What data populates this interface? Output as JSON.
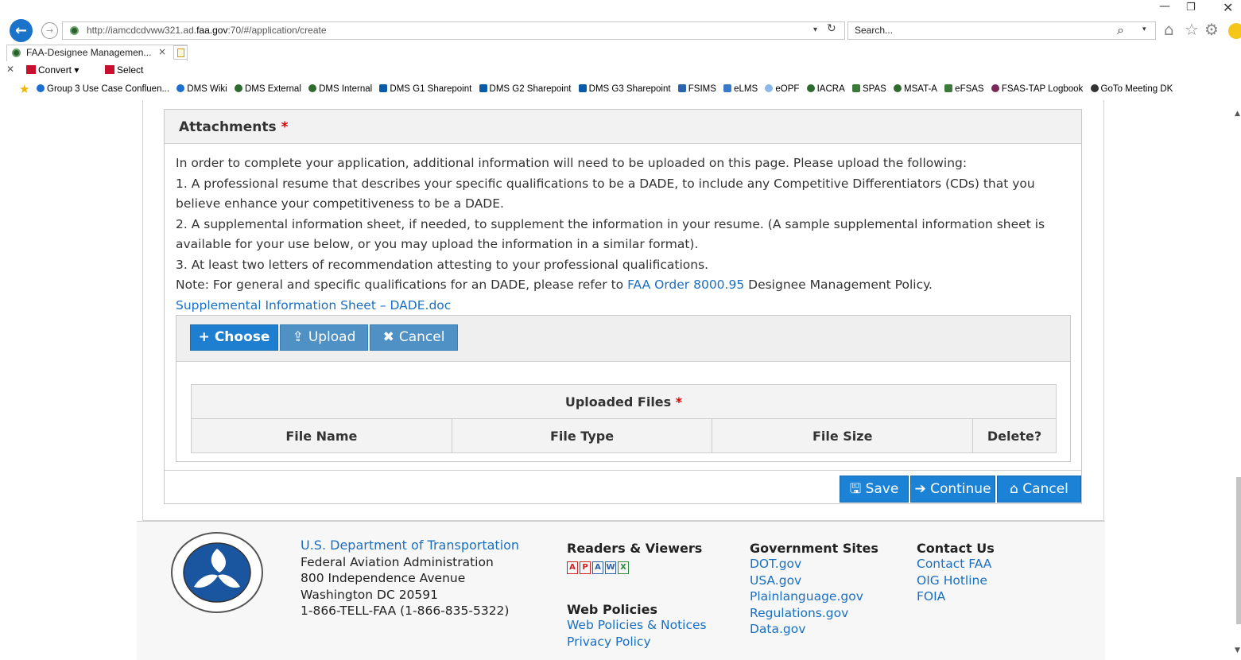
{
  "browser": {
    "url_prefix": "http://iamcdcdvww321.ad.",
    "url_domain": "faa.gov",
    "url_suffix": ":70/#/application/create",
    "search_placeholder": "Search...",
    "tab_title": "FAA-Designee Managemen...",
    "tab_close": "×",
    "window_min": "—",
    "window_restore": "❐",
    "window_close": "✕",
    "command_bar": {
      "close": "✕",
      "convert": "Convert",
      "convert_caret": "▾",
      "select": "Select"
    },
    "favorites": [
      "Group 3 Use Case Confluen...",
      "DMS Wiki",
      "DMS External",
      "DMS Internal",
      "DMS G1 Sharepoint",
      "DMS G2 Sharepoint",
      "DMS G3 Sharepoint",
      "FSIMS",
      "eLMS",
      "eOPF",
      "IACRA",
      "SPAS",
      "MSAT-A",
      "eFSAS",
      "FSAS-TAP Logbook",
      "GoTo Meeting DK"
    ]
  },
  "attachments": {
    "title": "Attachments",
    "required_marker": "*",
    "intro": "In order to complete your application, additional information will need to be uploaded on this page. Please upload the following:",
    "item1": "1. A professional resume that describes your specific qualifications to be a DADE, to include any Competitive Differentiators (CDs) that you believe enhance your competitiveness to be a DADE.",
    "item2": "2. A supplemental information sheet, if needed, to supplement the information in your resume. (A sample supplemental information sheet is available for your use below, or you may upload the information in a similar format).",
    "item3": "3. At least two letters of recommendation attesting to your professional qualifications.",
    "note_prefix": "Note: For general and specific qualifications for an DADE, please refer to ",
    "note_link": "FAA Order 8000.95",
    "note_suffix": " Designee Management Policy.",
    "sample_link": "Supplemental Information Sheet – DADE.doc",
    "uploader": {
      "choose": "Choose",
      "upload": "Upload",
      "cancel": "Cancel"
    },
    "files_table": {
      "title": "Uploaded Files",
      "columns": [
        "File Name",
        "File Type",
        "File Size",
        "Delete?"
      ]
    }
  },
  "actions": {
    "save": "Save",
    "continue": "Continue",
    "cancel": "Cancel"
  },
  "footer": {
    "dept_link": "U.S. Department of Transportation",
    "address": [
      "Federal Aviation Administration",
      "800 Independence Avenue",
      "Washington DC 20591",
      "1-866-TELL-FAA (1-866-835-5322)"
    ],
    "readers_title": "Readers & Viewers",
    "web_policies_title": "Web Policies",
    "web_policies_links": [
      "Web Policies & Notices",
      "Privacy Policy"
    ],
    "gov_sites_title": "Government Sites",
    "gov_sites_links": [
      "DOT.gov",
      "USA.gov",
      "Plainlanguage.gov",
      "Regulations.gov",
      "Data.gov"
    ],
    "contact_title": "Contact Us",
    "contact_links": [
      "Contact FAA",
      "OIG Hotline",
      "FOIA"
    ]
  },
  "colors": {
    "primary_button": "#1b82d6",
    "link": "#1a6fc0",
    "required": "#dd0000"
  }
}
